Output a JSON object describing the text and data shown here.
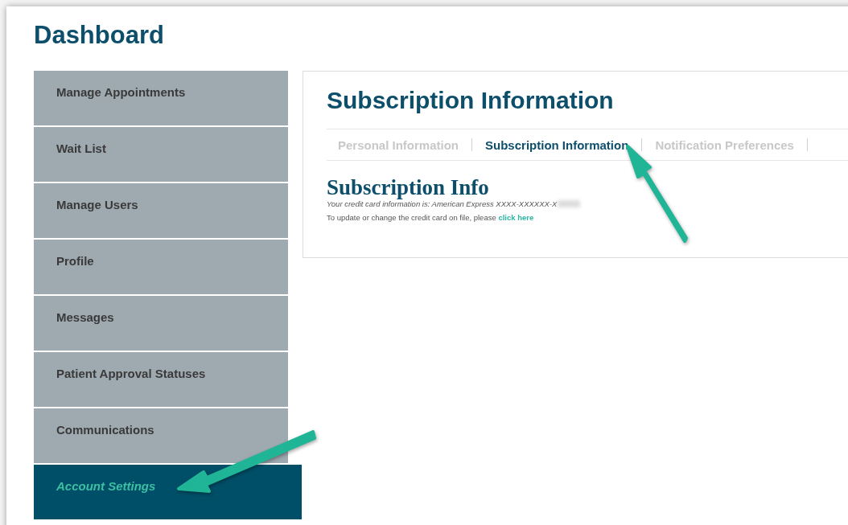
{
  "page": {
    "title": "Dashboard"
  },
  "sidebar": {
    "items": [
      {
        "label": "Manage Appointments",
        "selected": false
      },
      {
        "label": "Wait List",
        "selected": false
      },
      {
        "label": "Manage Users",
        "selected": false
      },
      {
        "label": "Profile",
        "selected": false
      },
      {
        "label": "Messages",
        "selected": false
      },
      {
        "label": "Patient Approval Statuses",
        "selected": false
      },
      {
        "label": "Communications",
        "selected": false
      },
      {
        "label": "Account Settings",
        "selected": true
      }
    ]
  },
  "panel": {
    "title": "Subscription Information",
    "tabs": [
      {
        "label": "Personal Information",
        "selected": false
      },
      {
        "label": "Subscription Information",
        "selected": true
      },
      {
        "label": "Notification Preferences",
        "selected": false
      }
    ],
    "section": {
      "heading": "Subscription Info",
      "card_text": "Your credit card information is: American Express XXXX-XXXXXX-X",
      "card_redacted": true,
      "update_text": "To update or change the credit card on file, please",
      "update_link": "click here"
    }
  },
  "callouts": [
    {
      "kind": "arrow"
    },
    {
      "kind": "arrow"
    }
  ]
}
